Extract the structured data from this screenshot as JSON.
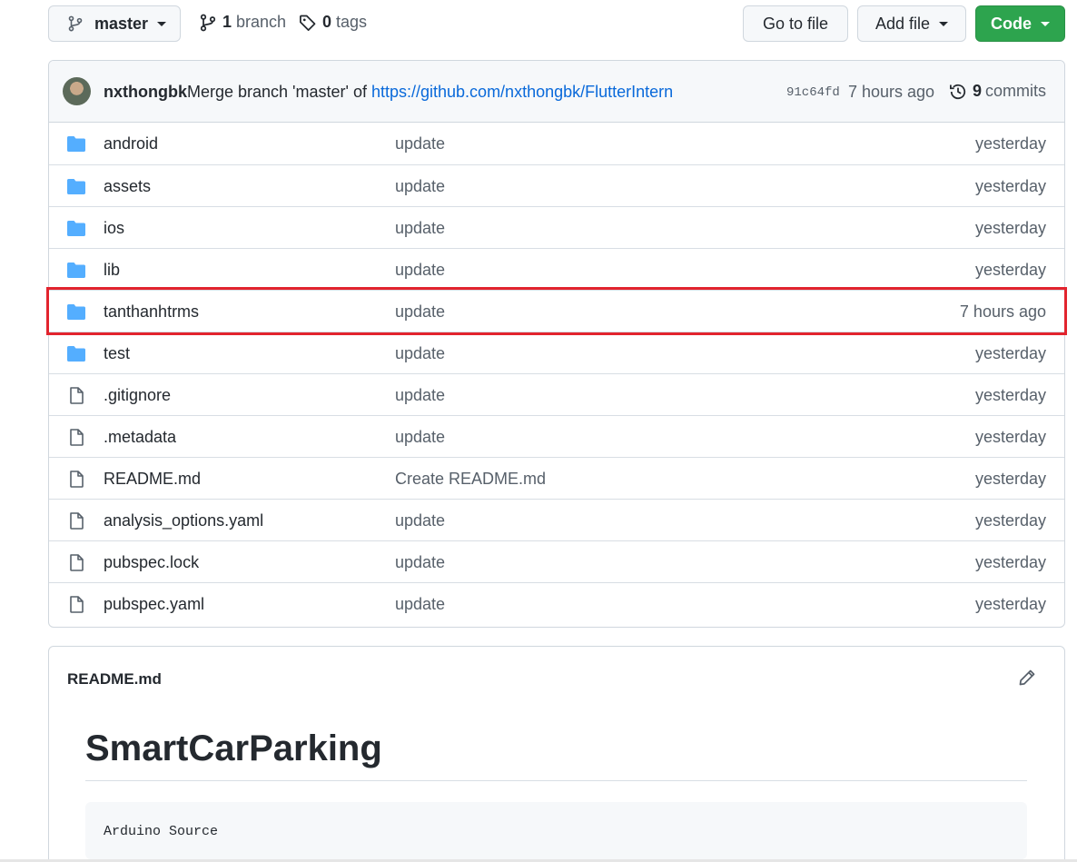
{
  "toolbar": {
    "branch_button": "master",
    "branches_count": "1",
    "branches_label": "branch",
    "tags_count": "0",
    "tags_label": "tags",
    "go_to_file": "Go to file",
    "add_file": "Add file",
    "code": "Code"
  },
  "commit": {
    "author": "nxthongbk",
    "message": "Merge branch 'master' of",
    "link": "https://github.com/nxthongbk/FlutterIntern",
    "sha": "91c64fd",
    "time": "7 hours ago",
    "count": "9",
    "count_label": "commits"
  },
  "files": [
    {
      "type": "folder",
      "name": "android",
      "message": "update",
      "age": "yesterday"
    },
    {
      "type": "folder",
      "name": "assets",
      "message": "update",
      "age": "yesterday"
    },
    {
      "type": "folder",
      "name": "ios",
      "message": "update",
      "age": "yesterday"
    },
    {
      "type": "folder",
      "name": "lib",
      "message": "update",
      "age": "yesterday"
    },
    {
      "type": "folder",
      "name": "tanthanhtrms",
      "message": "update",
      "age": "7 hours ago"
    },
    {
      "type": "folder",
      "name": "test",
      "message": "update",
      "age": "yesterday"
    },
    {
      "type": "file",
      "name": ".gitignore",
      "message": "update",
      "age": "yesterday"
    },
    {
      "type": "file",
      "name": ".metadata",
      "message": "update",
      "age": "yesterday"
    },
    {
      "type": "file",
      "name": "README.md",
      "message": "Create README.md",
      "age": "yesterday"
    },
    {
      "type": "file",
      "name": "analysis_options.yaml",
      "message": "update",
      "age": "yesterday"
    },
    {
      "type": "file",
      "name": "pubspec.lock",
      "message": "update",
      "age": "yesterday"
    },
    {
      "type": "file",
      "name": "pubspec.yaml",
      "message": "update",
      "age": "yesterday"
    }
  ],
  "readme": {
    "filename": "README.md",
    "title": "SmartCarParking",
    "code": "Arduino Source"
  },
  "colors": {
    "accent_link": "#0969da",
    "code_button": "#2da44e",
    "folder_icon": "#54aeff",
    "highlight_box": "#e2242e"
  }
}
